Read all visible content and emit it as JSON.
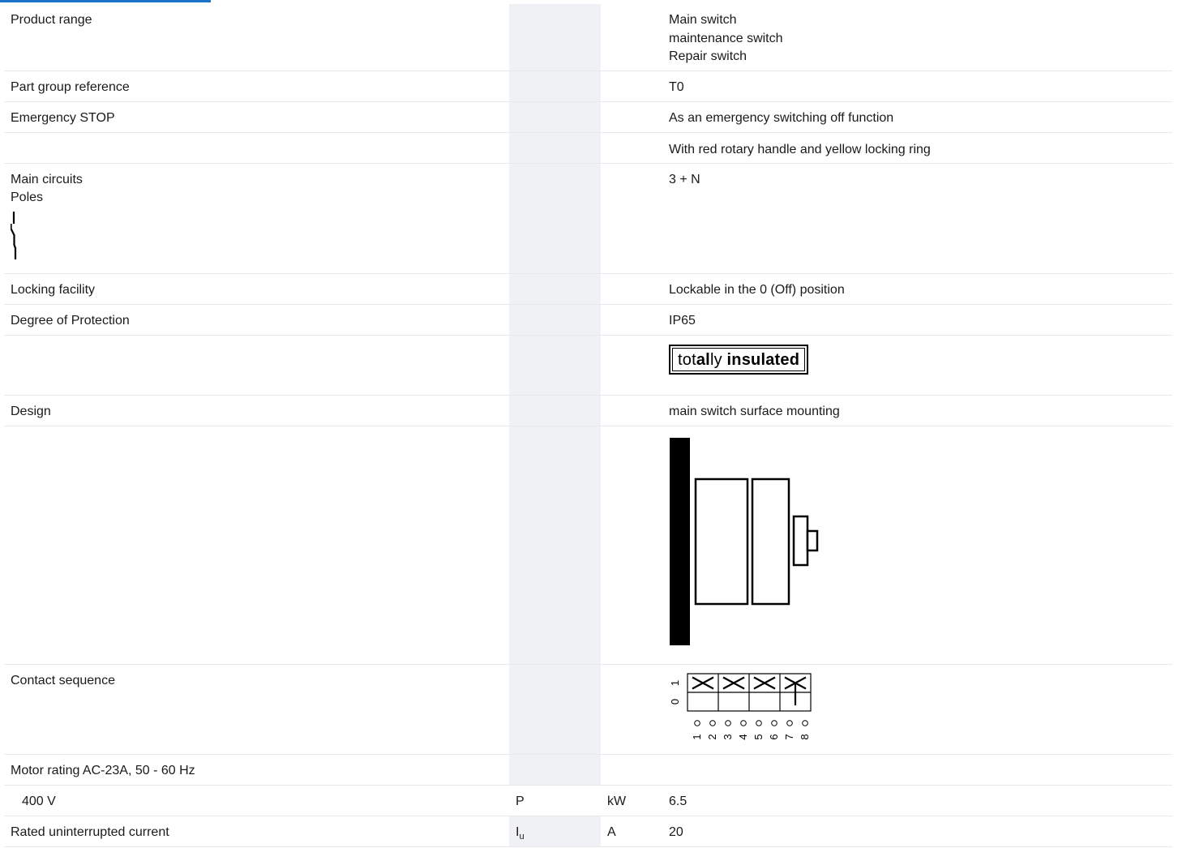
{
  "accent_color": "#1a73c8",
  "rows": [
    {
      "label": "Product range",
      "value": "Main switch\nmaintenance switch\nRepair switch"
    },
    {
      "label": "Part group reference",
      "value": "T0"
    },
    {
      "label": "Emergency STOP",
      "value": "As an emergency switching off function"
    },
    {
      "label": "",
      "value": "With red rotary handle and yellow locking ring"
    },
    {
      "label": "Main circuits\nPoles",
      "value": "3 + N"
    },
    {
      "label": "Locking facility",
      "value": "Lockable in the 0 (Off) position"
    },
    {
      "label": "Degree of Protection",
      "value": "IP65"
    },
    {
      "label": "Design",
      "value": "main switch surface mounting"
    },
    {
      "label": "Contact sequence"
    },
    {
      "label": "Motor rating AC-23A, 50 - 60 Hz"
    },
    {
      "label": "400 V",
      "symbol": "P",
      "unit": "kW",
      "value": "6.5"
    },
    {
      "label": "Rated uninterrupted current",
      "symbol": "I",
      "symbol_sub": "u",
      "unit": "A",
      "value": "20"
    }
  ],
  "insulation_badge": {
    "light": "tot",
    "light2": "ly",
    "bold_mid": "al",
    "bold_word": "insulated"
  },
  "contact_sequence": {
    "positions": [
      "1",
      "0"
    ],
    "terminals": [
      "1",
      "2",
      "3",
      "4",
      "5",
      "6",
      "7",
      "8"
    ]
  }
}
